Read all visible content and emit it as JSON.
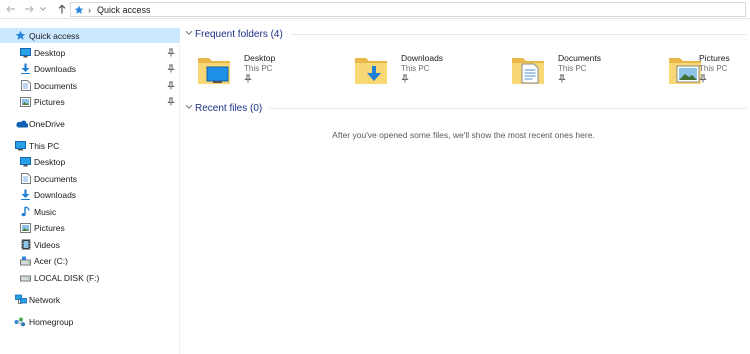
{
  "address_bar": {
    "breadcrumb": "Quick access"
  },
  "sidebar": {
    "quick_access": {
      "label": "Quick access"
    },
    "quick_items": [
      {
        "label": "Desktop",
        "icon": "desktop-icon",
        "pinned": true
      },
      {
        "label": "Downloads",
        "icon": "downloads-icon",
        "pinned": true
      },
      {
        "label": "Documents",
        "icon": "documents-icon",
        "pinned": true
      },
      {
        "label": "Pictures",
        "icon": "pictures-icon",
        "pinned": true
      }
    ],
    "onedrive": {
      "label": "OneDrive",
      "icon": "onedrive-icon"
    },
    "this_pc": {
      "label": "This PC",
      "icon": "this-pc-icon"
    },
    "pc_items": [
      {
        "label": "Desktop",
        "icon": "desktop-icon"
      },
      {
        "label": "Documents",
        "icon": "documents-icon"
      },
      {
        "label": "Downloads",
        "icon": "downloads-icon"
      },
      {
        "label": "Music",
        "icon": "music-icon"
      },
      {
        "label": "Pictures",
        "icon": "pictures-icon"
      },
      {
        "label": "Videos",
        "icon": "videos-icon"
      },
      {
        "label": "Acer (C:)",
        "icon": "drive-icon"
      },
      {
        "label": "LOCAL DISK (F:)",
        "icon": "drive-icon"
      }
    ],
    "network": {
      "label": "Network",
      "icon": "network-icon"
    },
    "homegroup": {
      "label": "Homegroup",
      "icon": "homegroup-icon"
    }
  },
  "main": {
    "frequent": {
      "title": "Frequent folders (4)",
      "folders": [
        {
          "name": "Desktop",
          "location": "This PC",
          "overlay": "desktop"
        },
        {
          "name": "Downloads",
          "location": "This PC",
          "overlay": "downloads"
        },
        {
          "name": "Documents",
          "location": "This PC",
          "overlay": "documents"
        },
        {
          "name": "Pictures",
          "location": "This PC",
          "overlay": "pictures"
        }
      ]
    },
    "recent": {
      "title": "Recent files (0)",
      "empty_message": "After you've opened some files, we'll show the most recent ones here."
    }
  },
  "colors": {
    "accent_blue": "#1e3287",
    "selection": "#cce8ff",
    "folder_yellow": "#f8d775",
    "icon_blue": "#1e7fd4"
  }
}
